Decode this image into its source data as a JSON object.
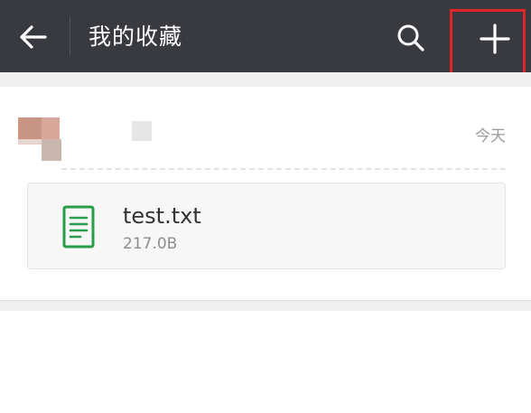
{
  "header": {
    "title": "我的收藏",
    "back_icon": "arrow-left-icon",
    "search_icon": "search-icon",
    "add_icon": "plus-icon",
    "background": "#393a3f"
  },
  "favorite": {
    "date": "今天",
    "file": {
      "name": "test.txt",
      "size": "217.0B",
      "icon": "text-file-icon",
      "icon_color": "#2a9d4a"
    }
  },
  "highlight_color": "#e0252b"
}
